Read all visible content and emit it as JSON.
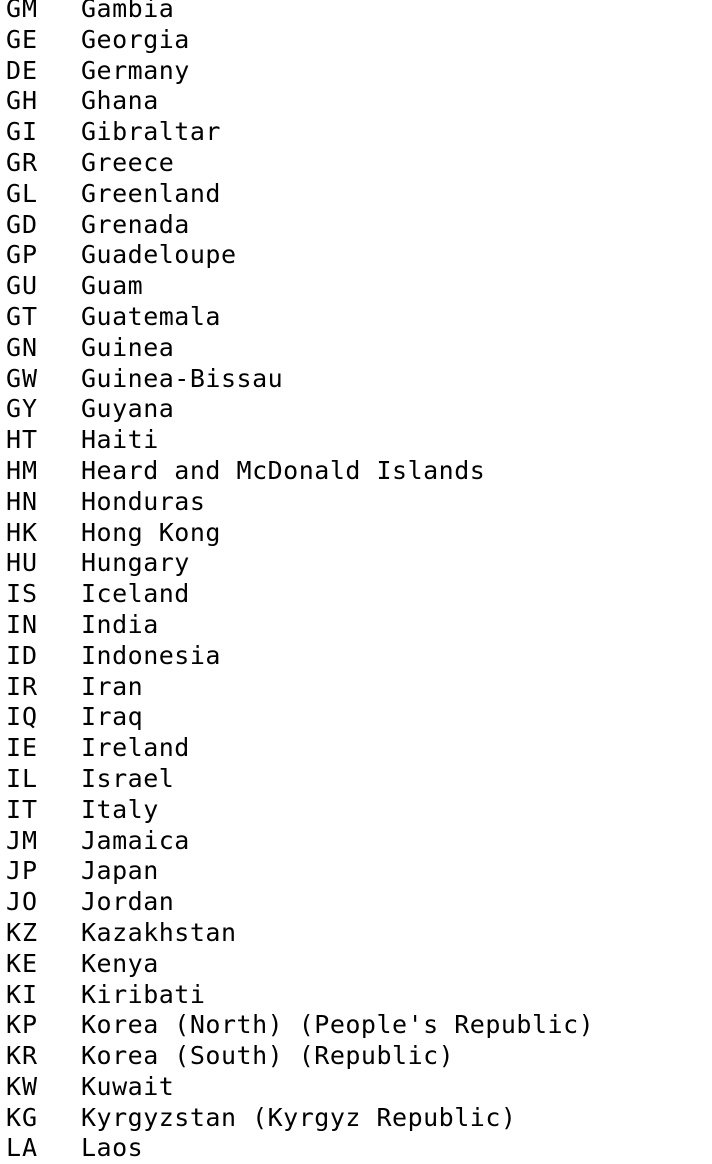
{
  "colors": {
    "text": "#000000",
    "background": "#ffffff"
  },
  "countries": [
    {
      "code": "GM",
      "name": "Gambia"
    },
    {
      "code": "GE",
      "name": "Georgia"
    },
    {
      "code": "DE",
      "name": "Germany"
    },
    {
      "code": "GH",
      "name": "Ghana"
    },
    {
      "code": "GI",
      "name": "Gibraltar"
    },
    {
      "code": "GR",
      "name": "Greece"
    },
    {
      "code": "GL",
      "name": "Greenland"
    },
    {
      "code": "GD",
      "name": "Grenada"
    },
    {
      "code": "GP",
      "name": "Guadeloupe"
    },
    {
      "code": "GU",
      "name": "Guam"
    },
    {
      "code": "GT",
      "name": "Guatemala"
    },
    {
      "code": "GN",
      "name": "Guinea"
    },
    {
      "code": "GW",
      "name": "Guinea-Bissau"
    },
    {
      "code": "GY",
      "name": "Guyana"
    },
    {
      "code": "HT",
      "name": "Haiti"
    },
    {
      "code": "HM",
      "name": "Heard and McDonald Islands"
    },
    {
      "code": "HN",
      "name": "Honduras"
    },
    {
      "code": "HK",
      "name": "Hong Kong"
    },
    {
      "code": "HU",
      "name": "Hungary"
    },
    {
      "code": "IS",
      "name": "Iceland"
    },
    {
      "code": "IN",
      "name": "India"
    },
    {
      "code": "ID",
      "name": "Indonesia"
    },
    {
      "code": "IR",
      "name": "Iran"
    },
    {
      "code": "IQ",
      "name": "Iraq"
    },
    {
      "code": "IE",
      "name": "Ireland"
    },
    {
      "code": "IL",
      "name": "Israel"
    },
    {
      "code": "IT",
      "name": "Italy"
    },
    {
      "code": "JM",
      "name": "Jamaica"
    },
    {
      "code": "JP",
      "name": "Japan"
    },
    {
      "code": "JO",
      "name": "Jordan"
    },
    {
      "code": "KZ",
      "name": "Kazakhstan"
    },
    {
      "code": "KE",
      "name": "Kenya"
    },
    {
      "code": "KI",
      "name": "Kiribati"
    },
    {
      "code": "KP",
      "name": "Korea (North) (People's Republic)"
    },
    {
      "code": "KR",
      "name": "Korea (South) (Republic)"
    },
    {
      "code": "KW",
      "name": "Kuwait"
    },
    {
      "code": "KG",
      "name": "Kyrgyzstan (Kyrgyz Republic)"
    },
    {
      "code": "LA",
      "name": "Laos"
    }
  ]
}
